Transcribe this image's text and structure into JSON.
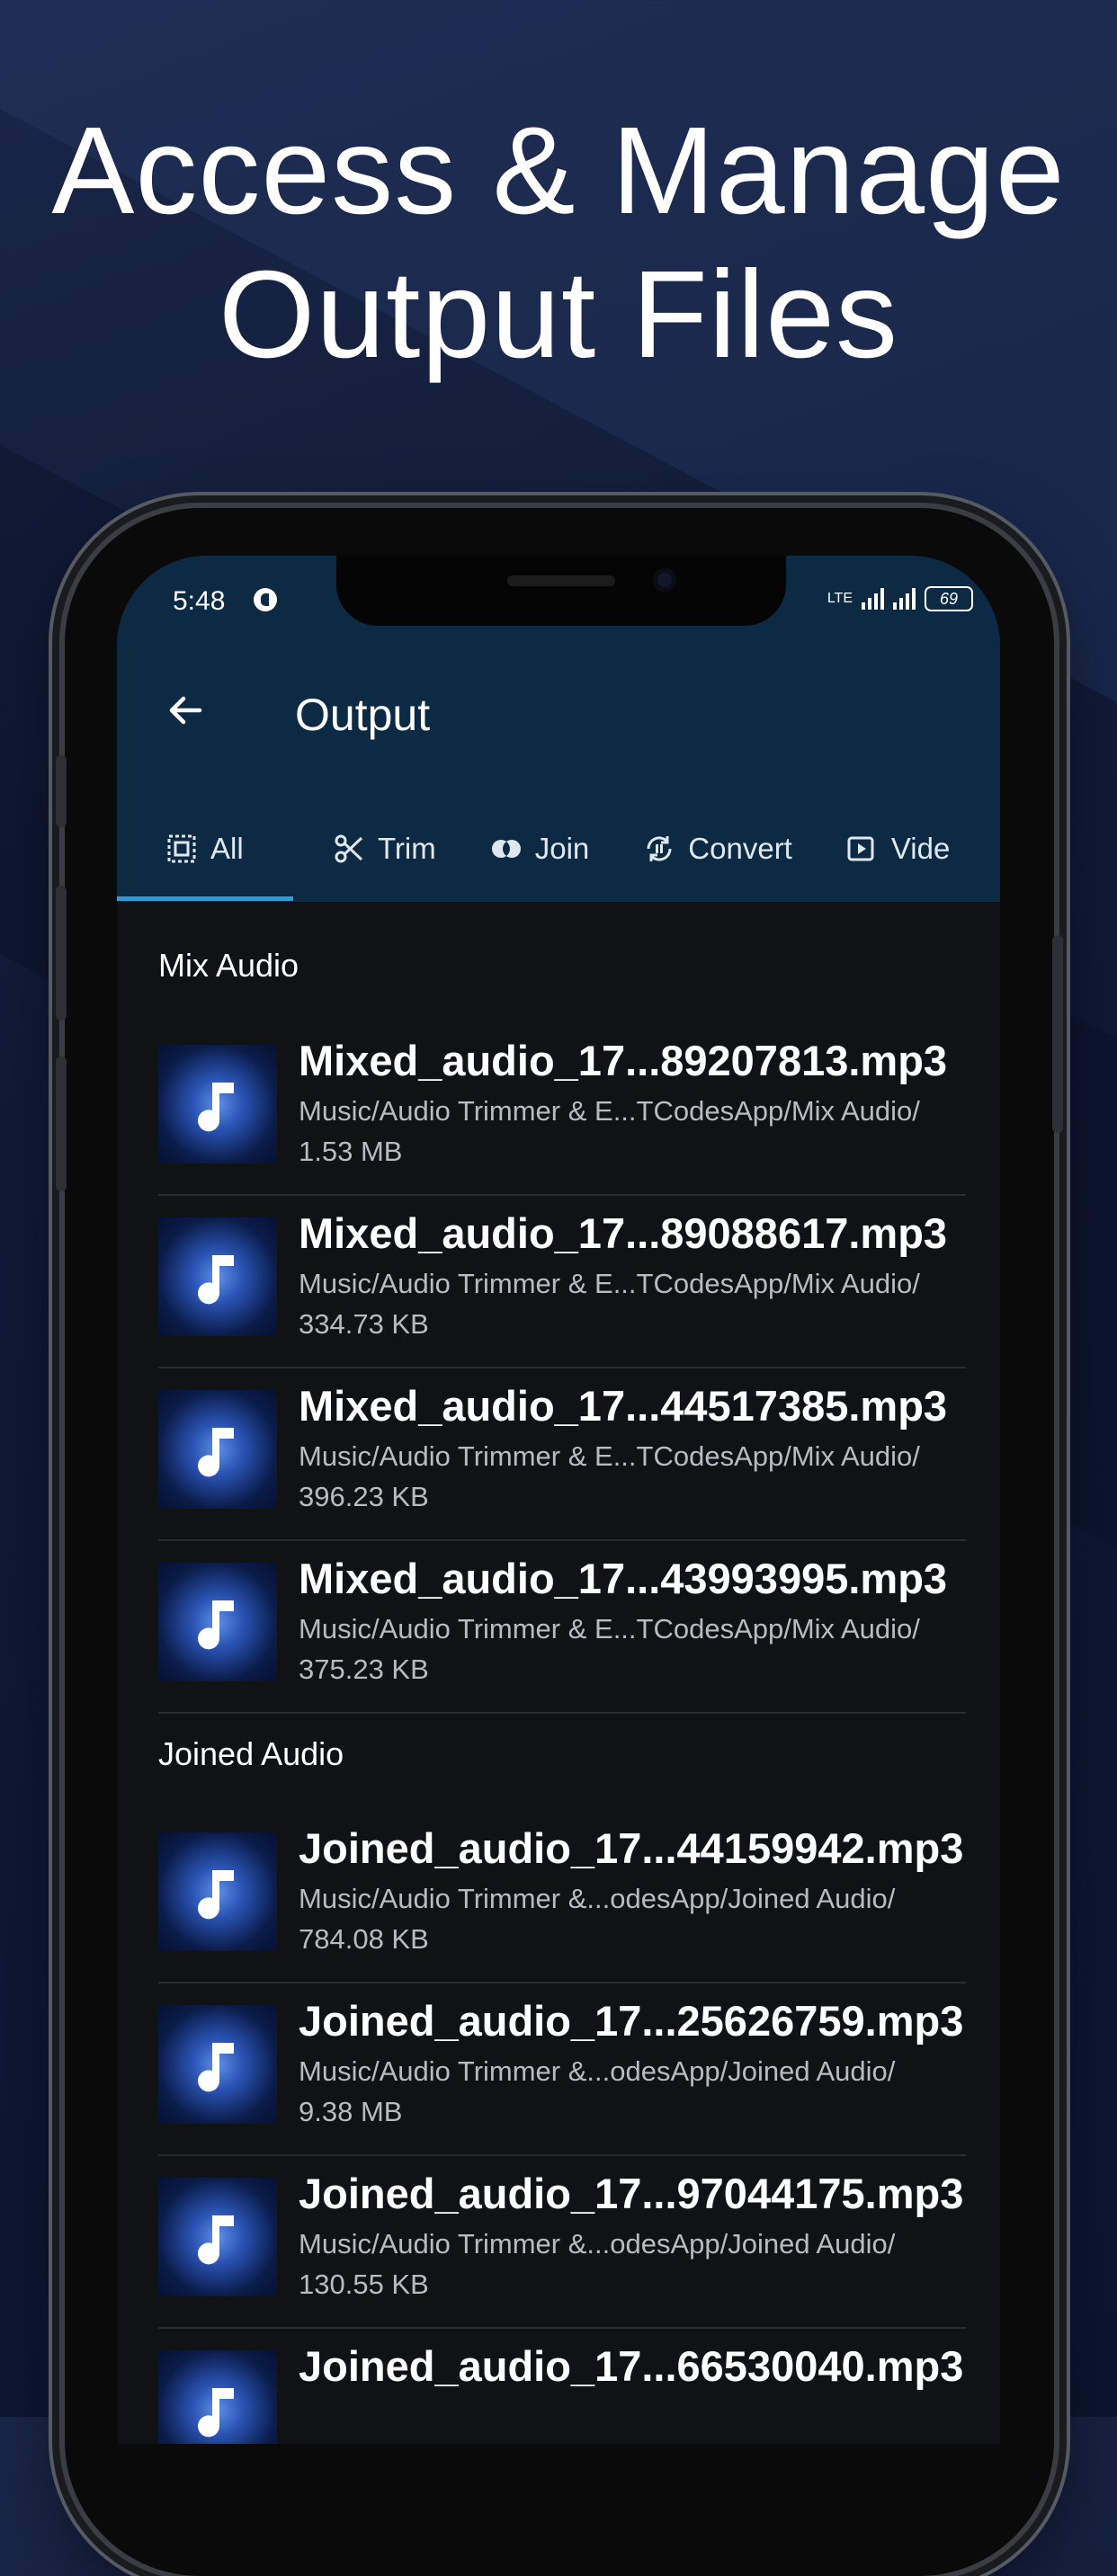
{
  "headline": {
    "line1": "Access & Manage",
    "line2": "Output Files"
  },
  "status_bar": {
    "time": "5:48",
    "network": "LTE",
    "battery": "69"
  },
  "app_bar": {
    "title": "Output",
    "back_icon": "arrow-left-icon"
  },
  "tabs": [
    {
      "label": "All",
      "icon": "select-all-icon",
      "active": true
    },
    {
      "label": "Trim",
      "icon": "scissors-icon",
      "active": false
    },
    {
      "label": "Join",
      "icon": "join-circles-icon",
      "active": false
    },
    {
      "label": "Convert",
      "icon": "convert-icon",
      "active": false
    },
    {
      "label": "Vide",
      "icon": "video-icon",
      "active": false
    }
  ],
  "sections": [
    {
      "title": "Mix Audio",
      "items": [
        {
          "name": "Mixed_audio_17...89207813.mp3",
          "path": "Music/Audio Trimmer & E...TCodesApp/Mix Audio/",
          "size": "1.53 MB"
        },
        {
          "name": "Mixed_audio_17...89088617.mp3",
          "path": "Music/Audio Trimmer & E...TCodesApp/Mix Audio/",
          "size": "334.73 KB"
        },
        {
          "name": "Mixed_audio_17...44517385.mp3",
          "path": "Music/Audio Trimmer & E...TCodesApp/Mix Audio/",
          "size": "396.23 KB"
        },
        {
          "name": "Mixed_audio_17...43993995.mp3",
          "path": "Music/Audio Trimmer & E...TCodesApp/Mix Audio/",
          "size": "375.23 KB"
        }
      ]
    },
    {
      "title": "Joined Audio",
      "items": [
        {
          "name": "Joined_audio_17...44159942.mp3",
          "path": "Music/Audio Trimmer &...odesApp/Joined Audio/",
          "size": "784.08 KB"
        },
        {
          "name": "Joined_audio_17...25626759.mp3",
          "path": "Music/Audio Trimmer &...odesApp/Joined Audio/",
          "size": "9.38 MB"
        },
        {
          "name": "Joined_audio_17...97044175.mp3",
          "path": "Music/Audio Trimmer &...odesApp/Joined Audio/",
          "size": "130.55 KB"
        },
        {
          "name": "Joined_audio_17...66530040.mp3",
          "path": "",
          "size": ""
        }
      ]
    }
  ],
  "colors": {
    "app_bar": "#0c2a44",
    "accent": "#2d9be0",
    "list_bg": "#111214",
    "secondary_text": "#b8bcc2"
  },
  "item_icon": "music-note-icon"
}
